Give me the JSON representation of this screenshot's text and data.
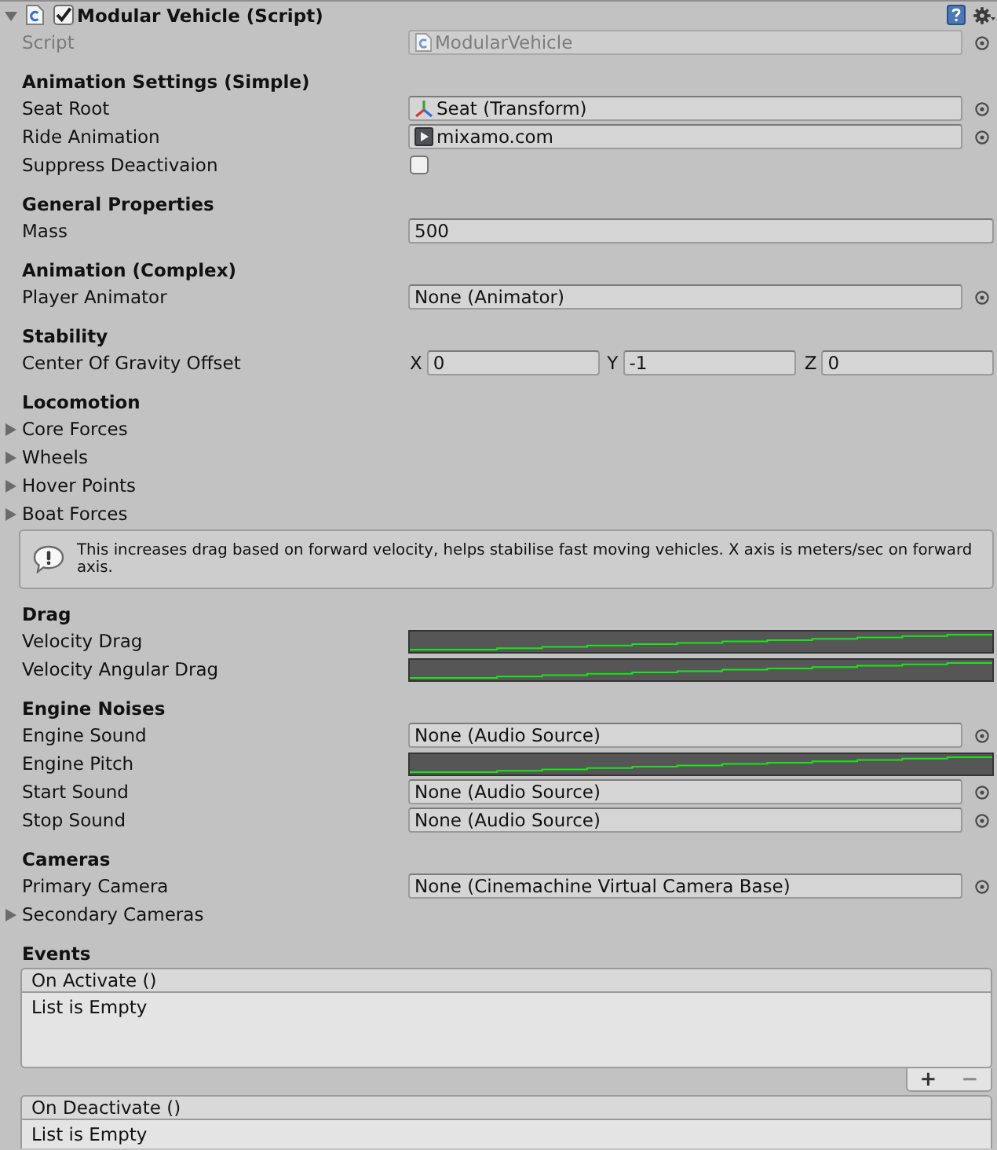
{
  "component": {
    "title": "Modular Vehicle (Script)",
    "expanded": true,
    "enabled": true
  },
  "script_field": {
    "label": "Script",
    "value": "ModularVehicle",
    "disabled": true
  },
  "sections": [
    {
      "heading": "Animation Settings (Simple)",
      "rows": [
        {
          "kind": "transform",
          "label": "Seat Root",
          "value": "Seat (Transform)"
        },
        {
          "kind": "clip",
          "label": "Ride Animation",
          "value": "mixamo.com"
        },
        {
          "kind": "checkbox",
          "label": "Suppress Deactivaion",
          "checked": false
        }
      ]
    },
    {
      "heading": "General Properties",
      "rows": [
        {
          "kind": "number",
          "label": "Mass",
          "value": "500"
        }
      ]
    },
    {
      "heading": "Animation (Complex)",
      "rows": [
        {
          "kind": "object",
          "label": "Player Animator",
          "value": "None (Animator)"
        }
      ]
    },
    {
      "heading": "Stability",
      "rows": [
        {
          "kind": "vector",
          "label": "Center Of Gravity Offset",
          "components": [
            {
              "axis": "X",
              "value": "0"
            },
            {
              "axis": "Y",
              "value": "-1"
            },
            {
              "axis": "Z",
              "value": "0"
            }
          ]
        }
      ]
    },
    {
      "heading": "Locomotion",
      "rows": [
        {
          "kind": "foldout",
          "label": "Core Forces",
          "expanded": false
        },
        {
          "kind": "foldout",
          "label": "Wheels",
          "expanded": false
        },
        {
          "kind": "foldout",
          "label": "Hover Points",
          "expanded": false
        },
        {
          "kind": "foldout",
          "label": "Boat Forces",
          "expanded": false
        },
        {
          "kind": "help",
          "text": "This increases drag based on forward velocity, helps stabilise fast moving vehicles. X axis is meters/sec on forward axis."
        }
      ]
    },
    {
      "heading": "Drag",
      "rows": [
        {
          "kind": "curve",
          "label": "Velocity Drag"
        },
        {
          "kind": "curve",
          "label": "Velocity Angular Drag"
        }
      ]
    },
    {
      "heading": "Engine Noises",
      "rows": [
        {
          "kind": "object",
          "label": "Engine Sound",
          "value": "None (Audio Source)"
        },
        {
          "kind": "curve",
          "label": "Engine Pitch"
        },
        {
          "kind": "object",
          "label": "Start Sound",
          "value": "None (Audio Source)"
        },
        {
          "kind": "object",
          "label": "Stop Sound",
          "value": "None (Audio Source)"
        }
      ]
    },
    {
      "heading": "Cameras",
      "rows": [
        {
          "kind": "object",
          "label": "Primary Camera",
          "value": "None (Cinemachine Virtual Camera Base)"
        },
        {
          "kind": "foldout",
          "label": "Secondary Cameras",
          "expanded": false
        }
      ]
    }
  ],
  "events": {
    "heading": "Events",
    "items": [
      {
        "title": "On Activate ()",
        "empty_text": "List is Empty",
        "add": "+",
        "remove": "−"
      },
      {
        "title": "On Deactivate ()",
        "empty_text": "List is Empty"
      }
    ]
  }
}
